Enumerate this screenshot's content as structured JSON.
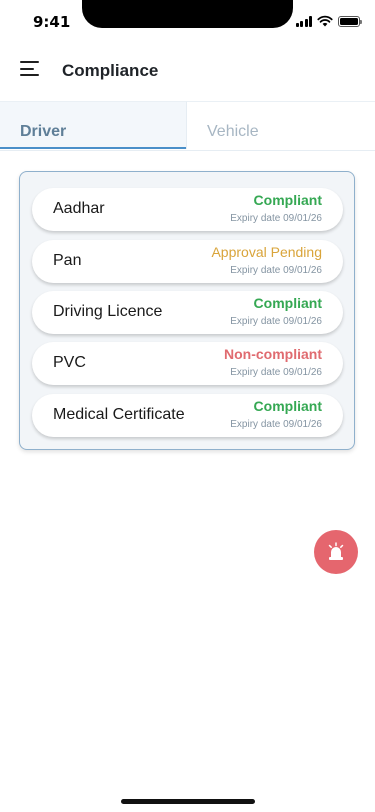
{
  "status_bar": {
    "time": "9:41",
    "icons": [
      "signal-icon",
      "wifi-icon",
      "battery-icon"
    ]
  },
  "header": {
    "title": "Compliance",
    "menu_icon": "menu-icon"
  },
  "tabs": [
    {
      "label": "Driver",
      "selected": true
    },
    {
      "label": "Vehicle",
      "selected": false
    }
  ],
  "documents": [
    {
      "name": "Aadhar",
      "status": "Compliant",
      "expiry": "Expiry date 09/01/26",
      "status_color": "#35a853"
    },
    {
      "name": "Pan",
      "status": "Approval Pending",
      "expiry": "Expiry date 09/01/26",
      "status_color": "#d9a43a"
    },
    {
      "name": "Driving Licence",
      "status": "Compliant",
      "expiry": "Expiry date 09/01/26",
      "status_color": "#35a853"
    },
    {
      "name": "PVC",
      "status": "Non-compliant",
      "expiry": "Expiry date 09/01/26",
      "status_color": "#e06b70"
    },
    {
      "name": "Medical Certificate",
      "status": "Compliant",
      "expiry": "Expiry date 09/01/26",
      "status_color": "#35a853"
    }
  ],
  "sos": {
    "icon": "alarm-siren-icon",
    "color": "#e5666e"
  },
  "colors": {
    "accent": "#4a8fc9",
    "card_border": "#8fb0cc"
  }
}
